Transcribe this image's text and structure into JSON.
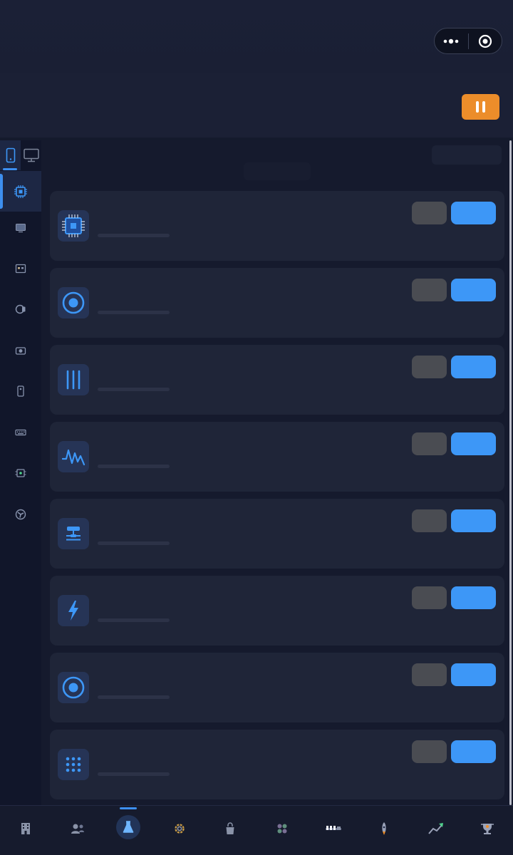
{
  "colors": {
    "accent": "#3d97f7",
    "pause": "#ec8d2a",
    "card": "#1f2538",
    "background": "#151a2d"
  },
  "capsule": {
    "more_icon": "more-dots-icon",
    "close_icon": "target-circle-icon"
  },
  "header": {
    "pause_icon": "pause-icon"
  },
  "sidebar": {
    "device_toggle": [
      {
        "icon": "phone-icon",
        "active": true
      },
      {
        "icon": "monitor-icon",
        "active": false
      }
    ],
    "items": [
      {
        "icon": "cpu-chip-icon",
        "active": true
      },
      {
        "icon": "display-icon",
        "active": false
      },
      {
        "icon": "screen-card-icon",
        "active": false
      },
      {
        "icon": "camera-lens-icon",
        "active": false
      },
      {
        "icon": "camera-icon",
        "active": false
      },
      {
        "icon": "phone-small-icon",
        "active": false
      },
      {
        "icon": "keyboard-icon",
        "active": false
      },
      {
        "icon": "circuit-icon",
        "active": false
      },
      {
        "icon": "fan-icon",
        "active": false
      }
    ]
  },
  "tests": [
    {
      "icon": "cpu-chip-icon"
    },
    {
      "icon": "record-circle-icon"
    },
    {
      "icon": "vertical-bars-icon"
    },
    {
      "icon": "waveform-icon"
    },
    {
      "icon": "sliders-icon"
    },
    {
      "icon": "lightning-icon"
    },
    {
      "icon": "record-circle-icon"
    },
    {
      "icon": "dot-grid-icon"
    }
  ],
  "tabbar": {
    "tabs": [
      {
        "icon": "building-icon",
        "active": false
      },
      {
        "icon": "users-icon",
        "active": false
      },
      {
        "icon": "flask-icon",
        "active": true
      },
      {
        "icon": "gear-icon",
        "active": false
      },
      {
        "icon": "bag-icon",
        "active": false
      },
      {
        "icon": "flower-icon",
        "active": false
      },
      {
        "icon": "level-meter-icon",
        "active": false
      },
      {
        "icon": "rocket-icon",
        "active": false
      },
      {
        "icon": "trend-chart-icon",
        "active": false
      },
      {
        "icon": "trophy-icon",
        "active": false
      }
    ]
  }
}
